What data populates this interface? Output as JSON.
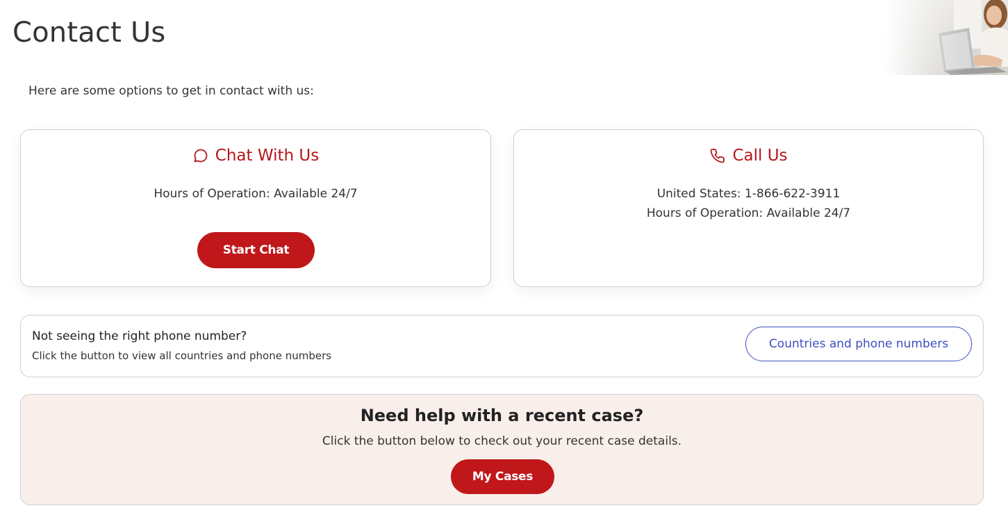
{
  "page": {
    "title": "Contact Us",
    "intro": "Here are some options to get in contact with us:"
  },
  "chat": {
    "title": "Chat With Us",
    "icon": "chat-bubble-icon",
    "hours": "Hours of Operation: Available 24/7",
    "button_label": "Start Chat"
  },
  "call": {
    "title": "Call Us",
    "icon": "phone-icon",
    "phone": "United States: 1-866-622-3911",
    "hours": "Hours of Operation: Available 24/7"
  },
  "phone_strip": {
    "title": "Not seeing the right phone number?",
    "subtitle": "Click the button to view all countries and phone numbers",
    "button_label": "Countries and phone numbers"
  },
  "cases": {
    "title": "Need help with a recent case?",
    "subtitle": "Click the button below to check out your recent case details.",
    "button_label": "My Cases"
  },
  "colors": {
    "brand_red": "#c0171b",
    "heading_red": "#b5161a",
    "link_blue": "#3b4fbf",
    "case_panel_bg": "#f8efea"
  }
}
